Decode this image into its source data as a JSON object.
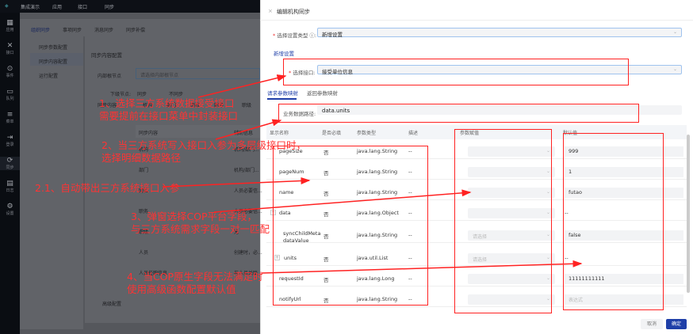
{
  "topbar": {
    "items": [
      "集成演示",
      "应用",
      "接口",
      "同步"
    ]
  },
  "sidenav": [
    {
      "icon": "grid-icon",
      "label": "应用"
    },
    {
      "icon": "interface-icon",
      "label": "接口"
    },
    {
      "icon": "event-icon",
      "label": "事件"
    },
    {
      "icon": "queue-icon",
      "label": "队列"
    },
    {
      "icon": "menu-icon",
      "label": "菜单"
    },
    {
      "icon": "login-icon",
      "label": "登录"
    },
    {
      "icon": "sync-icon",
      "label": "同步"
    },
    {
      "icon": "log-icon",
      "label": "日志"
    },
    {
      "icon": "gear-icon",
      "label": "设置"
    }
  ],
  "background": {
    "tabs": [
      "组织同步",
      "事项同步",
      "消息同步",
      "同步补偿"
    ],
    "menu": [
      "同步参数配置",
      "同步内容配置",
      "运行配置"
    ],
    "title": "同步内容配置",
    "root_label": "内部根节点",
    "root_placeholder": "请选择内部根节点",
    "sub_label": "下级节点:",
    "sub_options": [
      "同步",
      "不同步"
    ],
    "content_label": "同步内容",
    "content_options": [
      "机构",
      "部门",
      "岗位",
      "职务",
      "职级"
    ],
    "table_headers": [
      "同步内容",
      "辅助信息"
    ],
    "rows": [
      [
        "机构",
        "机构/部门..."
      ],
      [
        "部门",
        "机构/部门..."
      ],
      [
        "岗位",
        "人员必要信..."
      ],
      [
        "职务",
        "人员必要信..."
      ],
      [
        "职级",
        "无"
      ],
      [
        "人员",
        "创建时，必..."
      ],
      [
        "人员任职信息",
        "与人员关联..."
      ]
    ],
    "advanced": "高级配置"
  },
  "drawer": {
    "title": "编辑机构同步",
    "type_label": "选择设置类型",
    "type_value": "新增设置",
    "section_tab": "新增设置",
    "interface_label": "选择接口:",
    "interface_value": "接受单位信息",
    "tabs": [
      "请求参数映射",
      "返回参数映射"
    ],
    "path_label": "业务数据路径:",
    "path_value": "data.units",
    "headers": [
      "显示名称",
      "是否必填",
      "参数类型",
      "描述",
      "参数赋值",
      "默认值"
    ],
    "rows": [
      {
        "name": "pageSize",
        "required": "否",
        "type": "java.lang.String",
        "desc": "--",
        "assign": "",
        "default": "999"
      },
      {
        "name": "pageNum",
        "required": "否",
        "type": "java.lang.String",
        "desc": "--",
        "assign": "",
        "default": "1"
      },
      {
        "name": "name",
        "required": "否",
        "type": "java.lang.String",
        "desc": "--",
        "assign": "",
        "default": "futao"
      },
      {
        "name": "data",
        "required": "否",
        "type": "java.lang.Object",
        "desc": "--",
        "assign": "",
        "default": "--"
      },
      {
        "name": "syncChildMetadataValue",
        "required": "否",
        "type": "java.lang.String",
        "desc": "--",
        "assign": "请选择",
        "default": "false"
      },
      {
        "name": "units",
        "required": "否",
        "type": "java.util.List",
        "desc": "--",
        "assign": "请选择",
        "default": "--"
      },
      {
        "name": "requestId",
        "required": "否",
        "type": "java.lang.Long",
        "desc": "--",
        "assign": "",
        "default": "11111111111"
      },
      {
        "name": "notifyUrl",
        "required": "否",
        "type": "java.lang.String",
        "desc": "--",
        "assign": "",
        "default_placeholder": "表达式"
      }
    ],
    "cancel": "取消",
    "confirm": "确定"
  },
  "annotations": {
    "a1": [
      "1、选择三方系统数据接受接口",
      "需要提前在接口菜单中封装接口"
    ],
    "a2": [
      "2、当三方系统写入接口入参为多层级接口时，",
      "选择明细数据路径"
    ],
    "a21": "2.1、自动带出三方系统接口入参",
    "a3": [
      "3、弹窗选择COP平台字段，",
      "与三方系统需求字段一对一匹配"
    ],
    "a4": [
      "4、当COP原生字段无法满足时",
      "使用高级函数配置默认值"
    ]
  },
  "colors": {
    "annotation": "#ff3333",
    "primary": "#1f3fa8"
  }
}
